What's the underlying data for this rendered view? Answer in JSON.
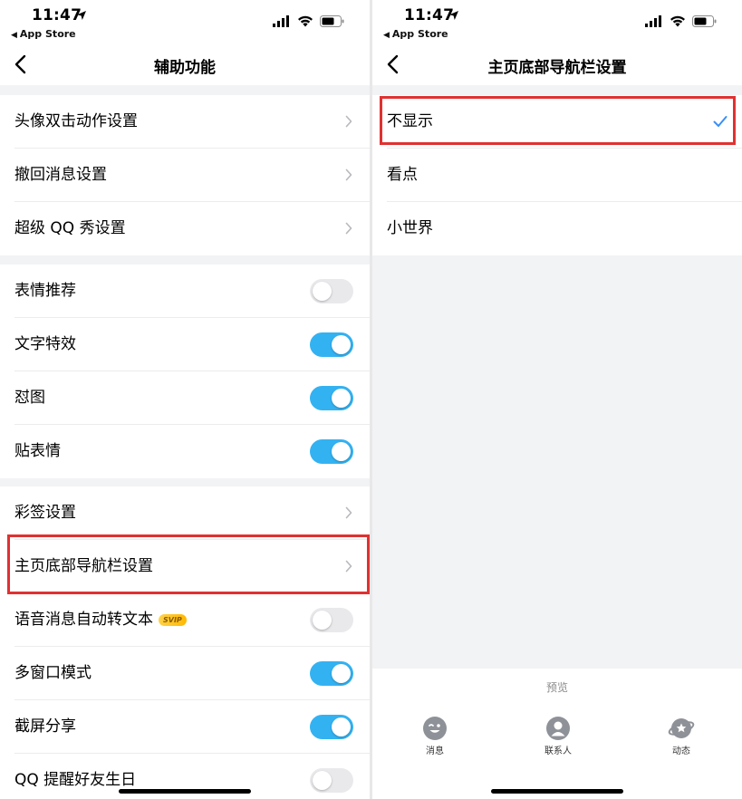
{
  "status_bar": {
    "time": "11:47",
    "back_app": "App Store"
  },
  "left": {
    "title": "辅助功能",
    "group1": [
      {
        "label": "头像双击动作设置"
      },
      {
        "label": "撤回消息设置"
      },
      {
        "label": "超级 QQ 秀设置"
      }
    ],
    "group2": [
      {
        "label": "表情推荐",
        "on": false
      },
      {
        "label": "文字特效",
        "on": true
      },
      {
        "label": "怼图",
        "on": true
      },
      {
        "label": "贴表情",
        "on": true
      }
    ],
    "group3": {
      "caiqian": "彩签设置",
      "nav_setting": "主页底部导航栏设置",
      "voice_to_text": "语音消息自动转文本",
      "voice_to_text_badge": "SVIP",
      "voice_to_text_on": false,
      "multi_window": "多窗口模式",
      "multi_window_on": true,
      "screenshot_share": "截屏分享",
      "screenshot_share_on": true,
      "birthday_remind": "QQ 提醒好友生日",
      "birthday_remind_on": false
    }
  },
  "right": {
    "title": "主页底部导航栏设置",
    "options": [
      {
        "label": "不显示",
        "selected": true
      },
      {
        "label": "看点",
        "selected": false
      },
      {
        "label": "小世界",
        "selected": false
      }
    ],
    "preview_label": "预览",
    "tabs": [
      {
        "label": "消息",
        "icon": "message-face-icon"
      },
      {
        "label": "联系人",
        "icon": "contacts-person-icon"
      },
      {
        "label": "动态",
        "icon": "dynamic-planet-icon"
      }
    ]
  },
  "colors": {
    "toggle_on": "#33b2f2",
    "toggle_off": "#e9e9ec",
    "highlight": "#e03131",
    "check": "#3a8ff7",
    "group_gap": "#f2f3f5"
  }
}
